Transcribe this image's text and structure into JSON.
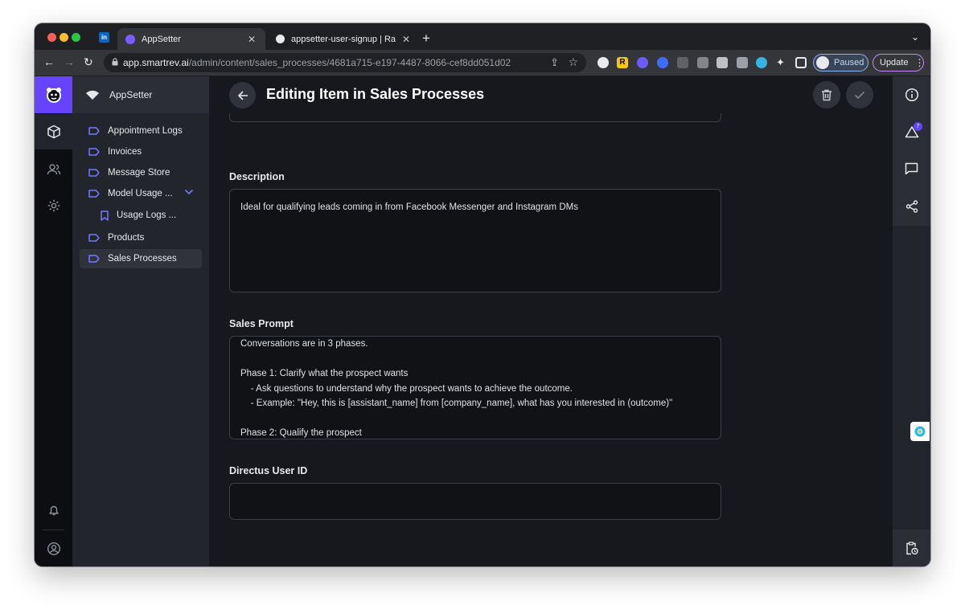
{
  "browser": {
    "tabs": [
      {
        "title": "AppSetter",
        "close": "✕"
      },
      {
        "title": "appsetter-user-signup | Railw",
        "close": "✕"
      }
    ],
    "linkedin_tab_label": "in",
    "new_tab": "+",
    "url_host": "app.smartrev.ai",
    "url_path": "/admin/content/sales_processes/4681a715-e197-4487-8066-cef8dd051d02",
    "profile_status": "Paused",
    "update_label": "Update",
    "extension_label": "R"
  },
  "app": {
    "project_name": "AppSetter",
    "page_title": "Editing Item in Sales Processes",
    "collections": [
      {
        "label": "Appointment Logs"
      },
      {
        "label": "Invoices"
      },
      {
        "label": "Message Store"
      },
      {
        "label": "Model Usage ..."
      },
      {
        "label": "Usage Logs ..."
      },
      {
        "label": "Products"
      },
      {
        "label": "Sales Processes"
      }
    ],
    "notifications_badge": "7",
    "fields": {
      "description": {
        "label": "Description",
        "value": "Ideal for qualifying leads coming in from Facebook Messenger and Instagram DMs"
      },
      "sales_prompt": {
        "label": "Sales Prompt",
        "value": "Conversations are in 3 phases.\n\nPhase 1: Clarify what the prospect wants\n    - Ask questions to understand why the prospect wants to achieve the outcome.\n    - Example: \"Hey, this is [assistant_name] from [company_name], what has you interested in (outcome)\"\n\nPhase 2: Qualify the prospect"
      },
      "directus_user_id": {
        "label": "Directus User ID",
        "value": ""
      }
    }
  },
  "colors": {
    "accent": "#6644ff",
    "background": "#16181d",
    "nav_panel": "#22252c"
  }
}
